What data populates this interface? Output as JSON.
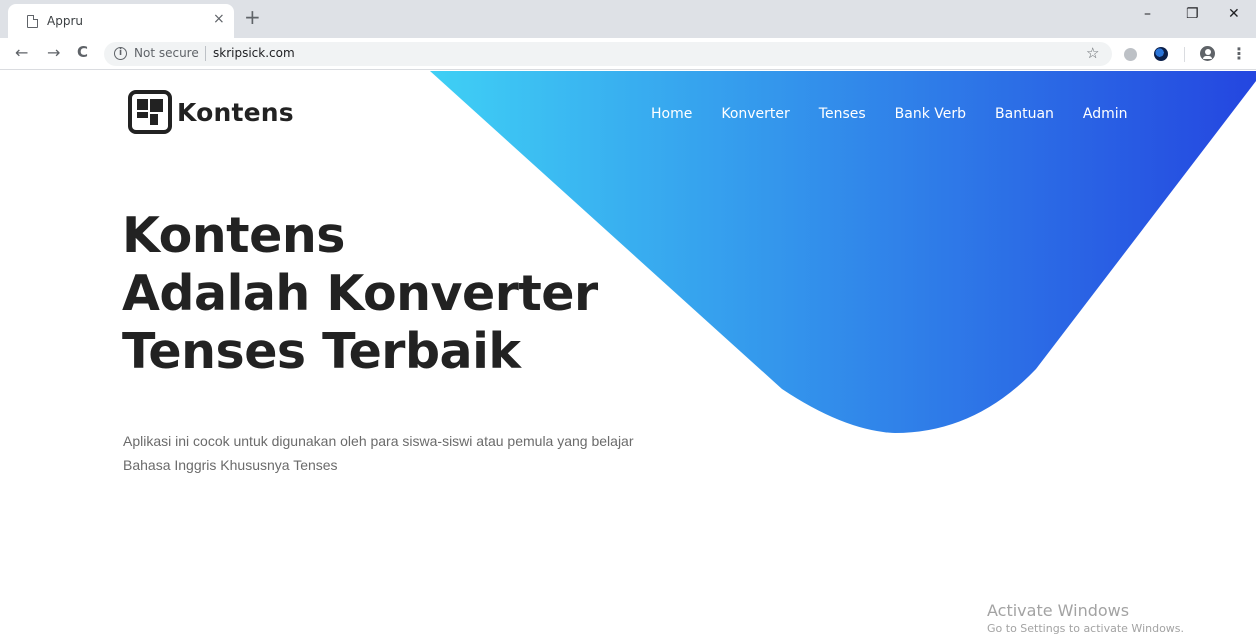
{
  "browser": {
    "tab_title": "Appru",
    "tab_close": "×",
    "new_tab": "+",
    "window_controls": {
      "minimize": "–",
      "restore": "❐",
      "close": "✕"
    },
    "nav": {
      "back": "←",
      "forward": "→",
      "reload": "C"
    },
    "security_label": "Not secure",
    "url": "skripsick.com",
    "star": "☆",
    "menu": "⋮"
  },
  "site": {
    "logo_text": "Kontens",
    "nav_items": [
      "Home",
      "Konverter",
      "Tenses",
      "Bank Verb",
      "Bantuan",
      "Admin"
    ],
    "hero": {
      "headline_lines": [
        "Kontens",
        "Adalah Konverter",
        "Tenses Terbaik"
      ],
      "description": "Aplikasi ini cocok untuk digunakan oleh para siswa-siswi atau pemula yang belajar Bahasa Inggris Khususnya Tenses"
    },
    "colors": {
      "gradient_start": "#3fd0f5",
      "gradient_end": "#2446e0",
      "heading": "#222222",
      "text": "#6b6b6b"
    }
  },
  "watermark": {
    "title": "Activate Windows",
    "subtitle": "Go to Settings to activate Windows."
  }
}
